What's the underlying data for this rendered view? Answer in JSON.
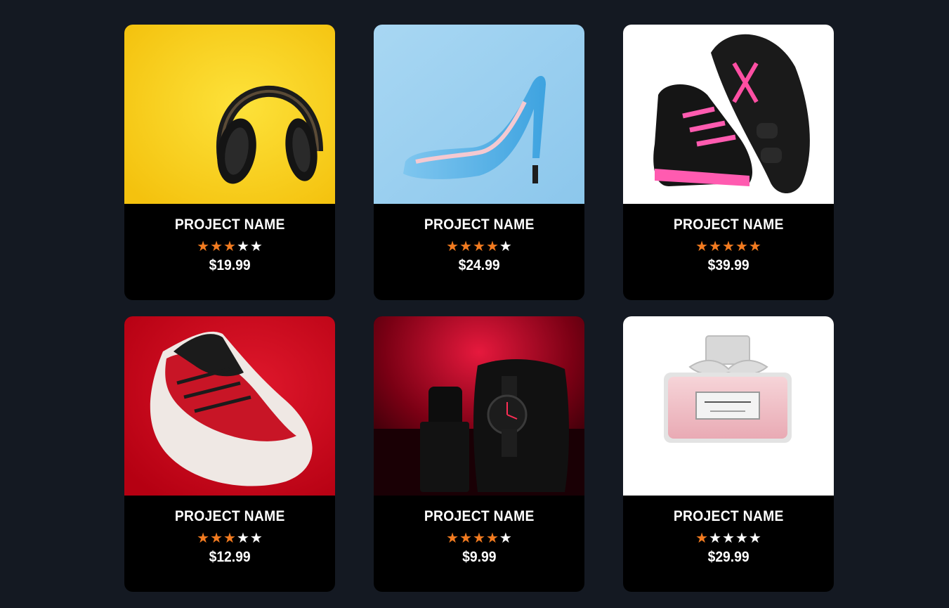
{
  "products": [
    {
      "name": "PROJECT NAME",
      "rating": 3,
      "price": "$19.99",
      "image": "headphones-photo"
    },
    {
      "name": "PROJECT NAME",
      "rating": 4,
      "price": "$24.99",
      "image": "blue-heel-photo"
    },
    {
      "name": "PROJECT NAME",
      "rating": 5,
      "price": "$39.99",
      "image": "roller-sneaker-photo"
    },
    {
      "name": "PROJECT NAME",
      "rating": 3,
      "price": "$12.99",
      "image": "red-sneaker-photo"
    },
    {
      "name": "PROJECT NAME",
      "rating": 4,
      "price": "$9.99",
      "image": "watch-photo"
    },
    {
      "name": "PROJECT NAME",
      "rating": 1,
      "price": "$29.99",
      "image": "perfume-photo"
    }
  ],
  "max_rating": 5,
  "colors": {
    "background": "#141922",
    "card": "#000000",
    "star_filled": "#f27b20",
    "star_empty": "#ffffff",
    "text": "#ffffff"
  }
}
